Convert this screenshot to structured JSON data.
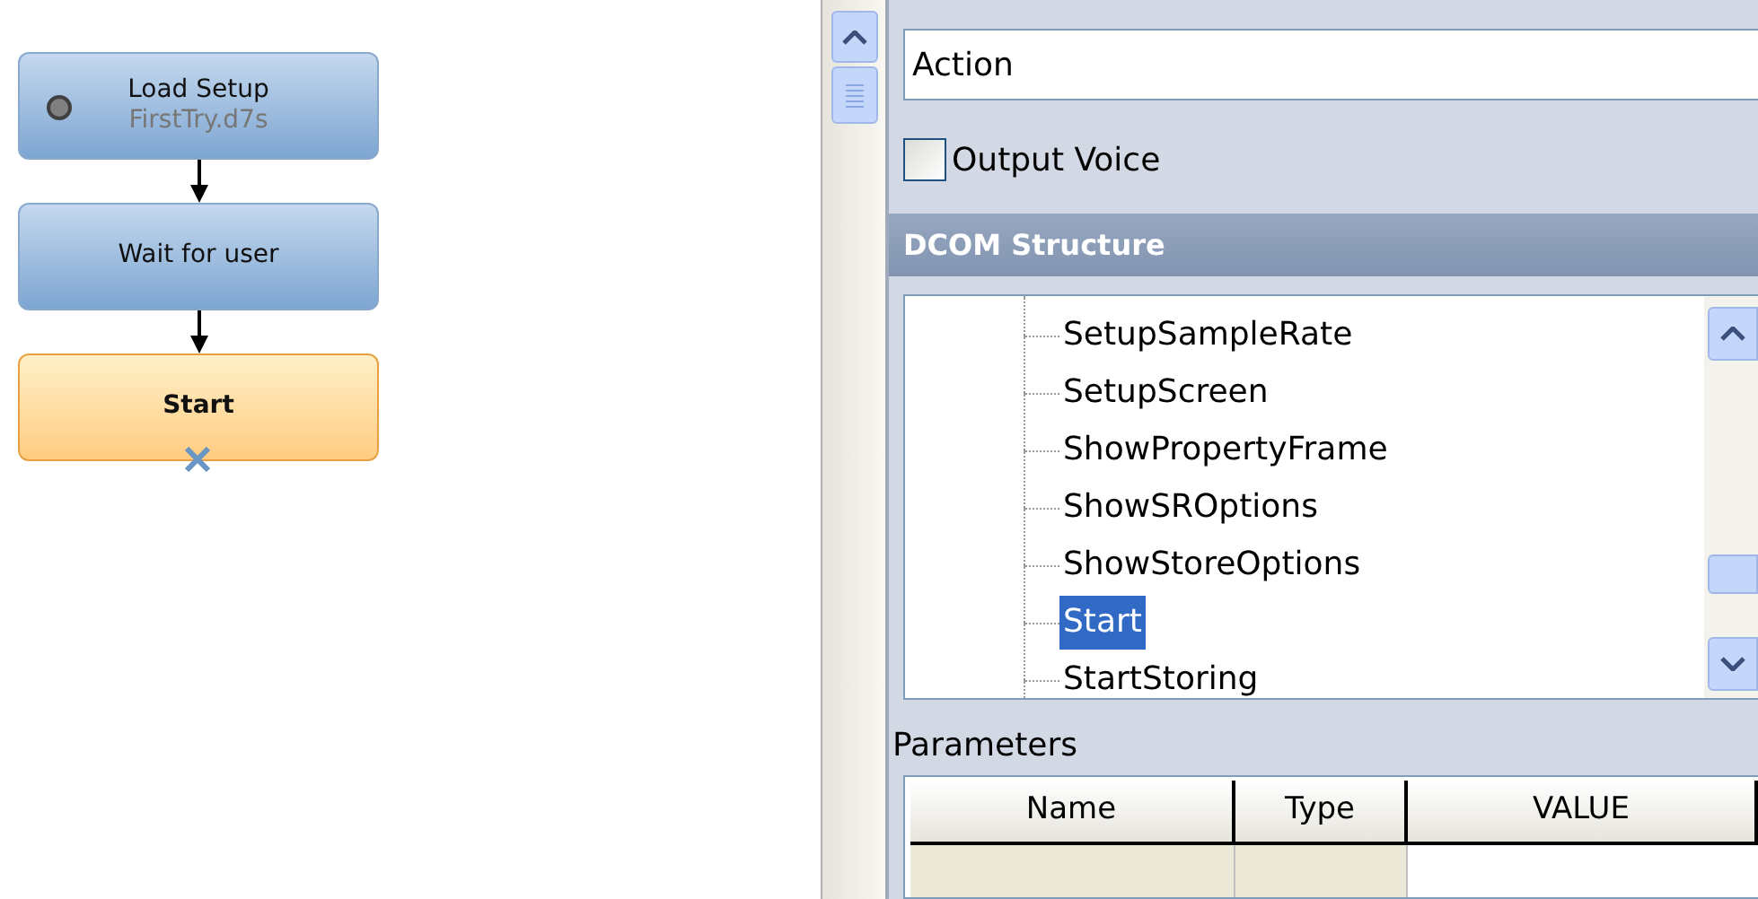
{
  "flow_nodes": [
    {
      "title": "Load Setup",
      "subtitle": "FirstTry.d7s",
      "kind": "setup",
      "selected": false
    },
    {
      "title": "Wait for user",
      "kind": "step",
      "selected": false
    },
    {
      "title": "Start",
      "kind": "step",
      "selected": true
    }
  ],
  "action_field": {
    "value": "Action"
  },
  "output_voice": {
    "label": "Output Voice",
    "checked": false
  },
  "dcom_section": {
    "title": "DCOM Structure",
    "items": [
      {
        "label": "SetupSampleRate",
        "selected": false
      },
      {
        "label": "SetupScreen",
        "selected": false
      },
      {
        "label": "ShowPropertyFrame",
        "selected": false
      },
      {
        "label": "ShowSROptions",
        "selected": false
      },
      {
        "label": "ShowStoreOptions",
        "selected": false
      },
      {
        "label": "Start",
        "selected": true
      },
      {
        "label": "StartStoring",
        "selected": false
      }
    ]
  },
  "parameters": {
    "title": "Parameters",
    "columns": [
      "Name",
      "Type",
      "VALUE"
    ]
  }
}
